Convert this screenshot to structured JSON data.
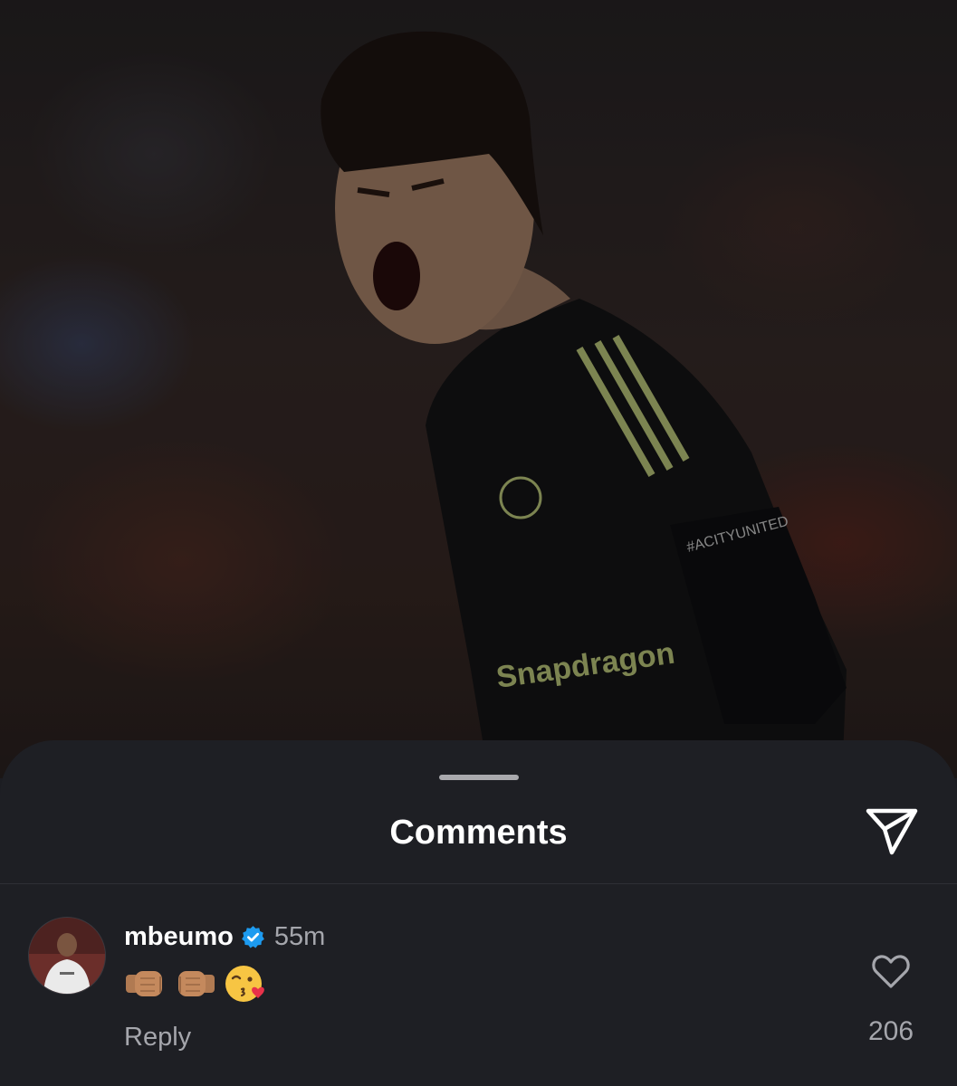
{
  "post": {
    "jersey_sponsor": "Snapdragon",
    "sleeve_text": "#ACITYUNITED"
  },
  "sheet": {
    "title": "Comments",
    "share_icon": "send-icon"
  },
  "comments": [
    {
      "username": "mbeumo",
      "verified": true,
      "time": "55m",
      "emojis": [
        "fist-bump-left-emoji",
        "fist-bump-right-emoji",
        "kissing-face-with-heart-emoji"
      ],
      "reply_label": "Reply",
      "like_count": "206",
      "like_icon": "heart-outline-icon"
    }
  ],
  "colors": {
    "sheet_bg": "#1e1f24",
    "text_primary": "#ffffff",
    "text_secondary": "#a5a6ac",
    "verified_badge": "#1d9bf0",
    "kit_accent": "#d5e38a"
  }
}
